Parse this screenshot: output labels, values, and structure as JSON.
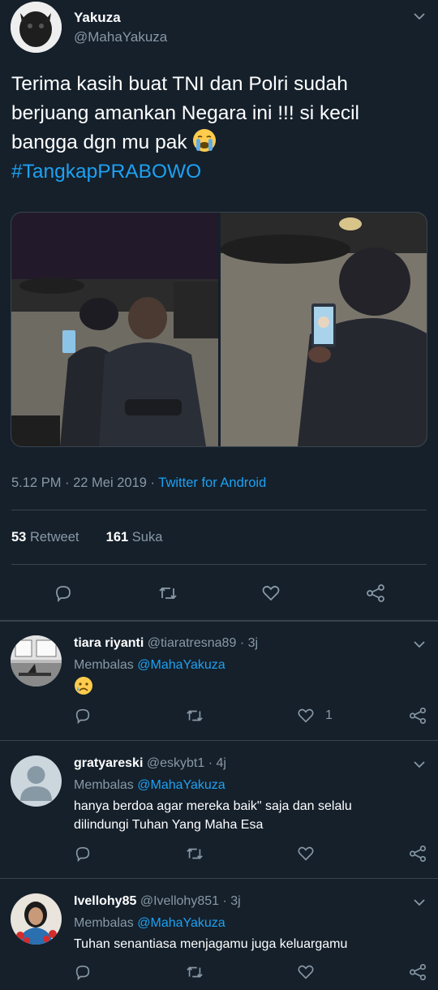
{
  "tweet": {
    "author_name": "Yakuza",
    "author_handle": "@MahaYakuza",
    "text_line1": "Terima kasih buat TNI dan Polri sudah",
    "text_line2": "berjuang amankan Negara ini !!! si kecil",
    "text_line3": "bangga dgn mu pak ",
    "hashtag": "#TangkapPRABOWO",
    "timestamp": "5.12 PM · 22 Mei 2019 · ",
    "source": "Twitter for Android",
    "retweet_count": "53",
    "retweet_label": "Retweet",
    "like_count": "161",
    "like_label": "Suka"
  },
  "replies": [
    {
      "name": "tiara riyanti",
      "handle": "@tiaratresna89",
      "time": "· 3j",
      "replying_prefix": "Membalas ",
      "replying_to": "@MahaYakuza",
      "text": "",
      "like_count": "1"
    },
    {
      "name": "gratyareski",
      "handle": "@eskybt1",
      "time": "· 4j",
      "replying_prefix": "Membalas ",
      "replying_to": "@MahaYakuza",
      "text_line1": "hanya berdoa agar mereka baik\" saja dan selalu",
      "text_line2": "dilindungi Tuhan Yang Maha Esa",
      "like_count": ""
    },
    {
      "name": "Ivellohy85",
      "handle": "@Ivellohy851",
      "time": "· 3j",
      "replying_prefix": "Membalas ",
      "replying_to": "@MahaYakuza",
      "text": "Tuhan senantiasa menjagamu juga keluargamu",
      "like_count": ""
    }
  ],
  "icons": [
    "chevron-down-icon",
    "reply-icon",
    "retweet-icon",
    "like-icon",
    "share-icon",
    "crying-face-emoji",
    "sad-face-emoji"
  ],
  "colors": {
    "background": "#15202b",
    "accent": "#1da1f2",
    "muted": "#8899a6",
    "divider": "#38444d"
  }
}
